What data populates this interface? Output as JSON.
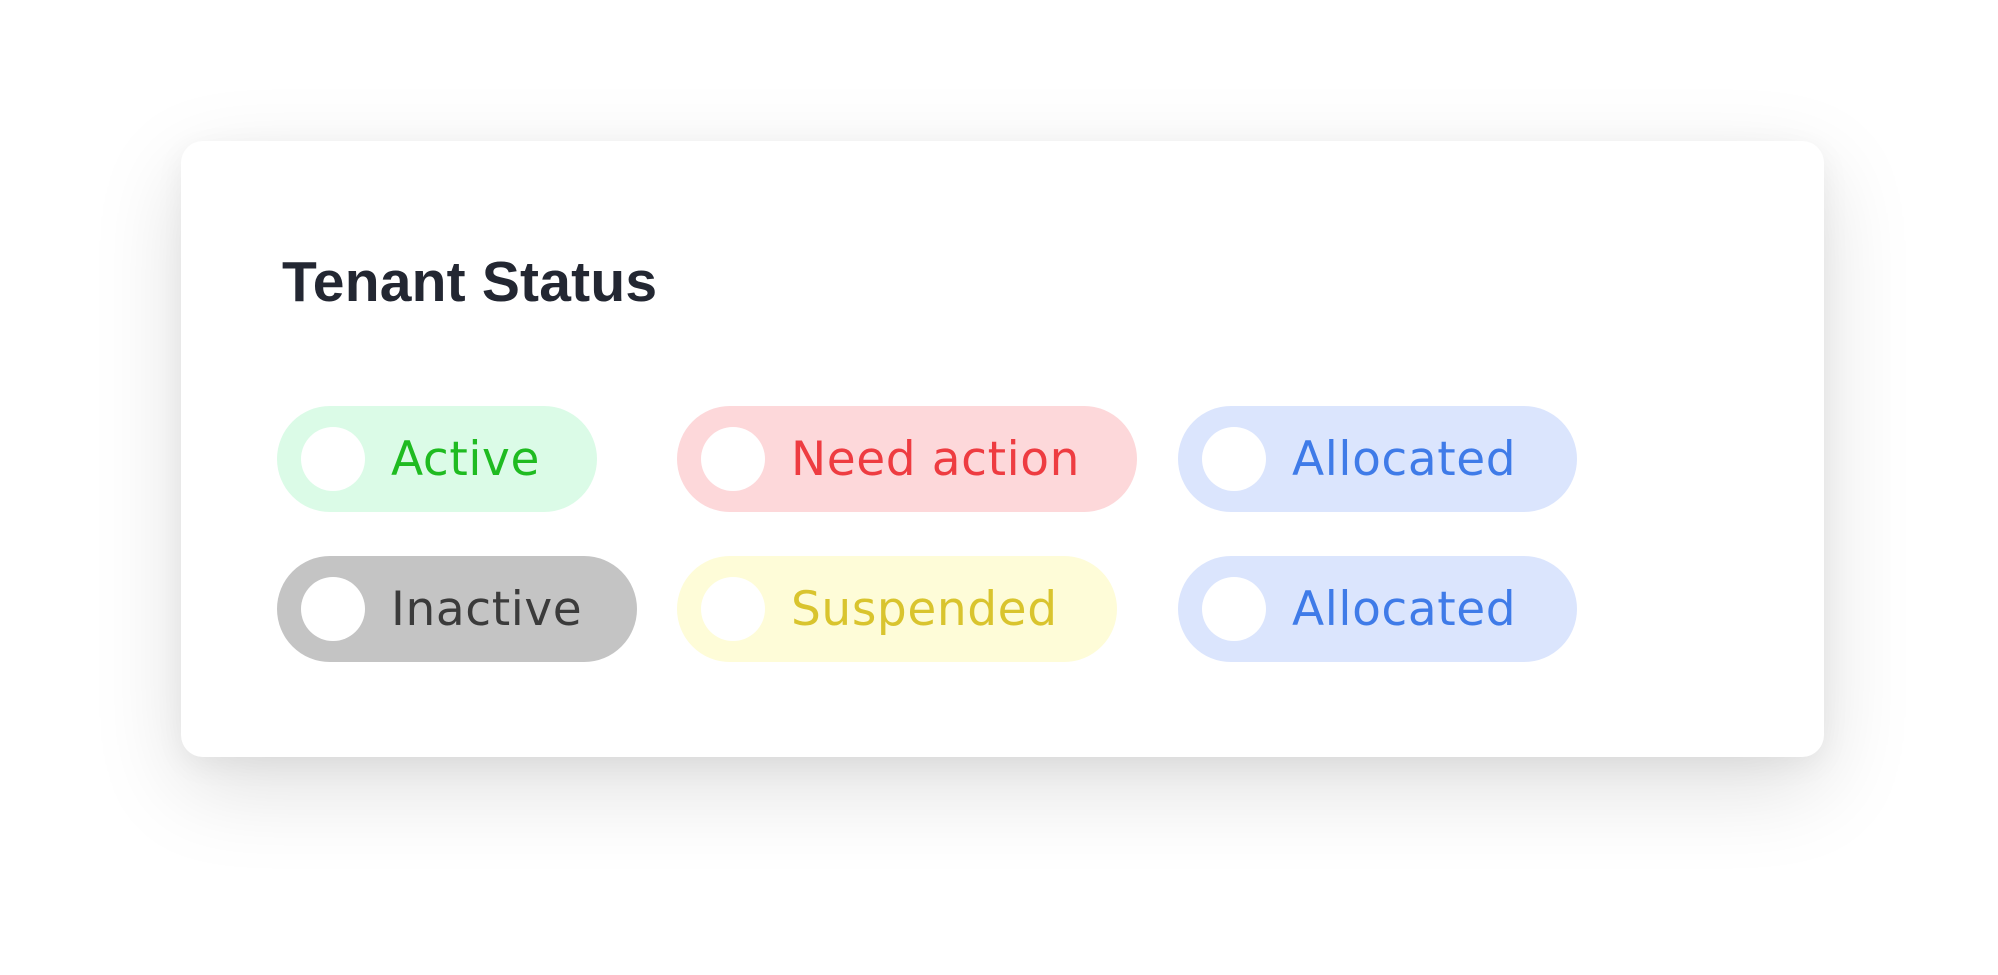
{
  "card": {
    "title": "Tenant Status"
  },
  "statuses": [
    {
      "id": "active",
      "label": "Active",
      "background": "#dbfbe7",
      "text_color": "#1fbb21"
    },
    {
      "id": "need",
      "label": "Need action",
      "background": "#fdd8da",
      "text_color": "#ee3c41"
    },
    {
      "id": "alloc1",
      "label": "Allocated",
      "background": "#dbe5fd",
      "text_color": "#3f7be8"
    },
    {
      "id": "inactive",
      "label": "Inactive",
      "background": "#c4c4c4",
      "text_color": "#3b3b3b"
    },
    {
      "id": "suspended",
      "label": "Suspended",
      "background": "#fefcd8",
      "text_color": "#d9c42e"
    },
    {
      "id": "alloc2",
      "label": "Allocated",
      "background": "#dbe5fd",
      "text_color": "#3f7be8"
    }
  ]
}
